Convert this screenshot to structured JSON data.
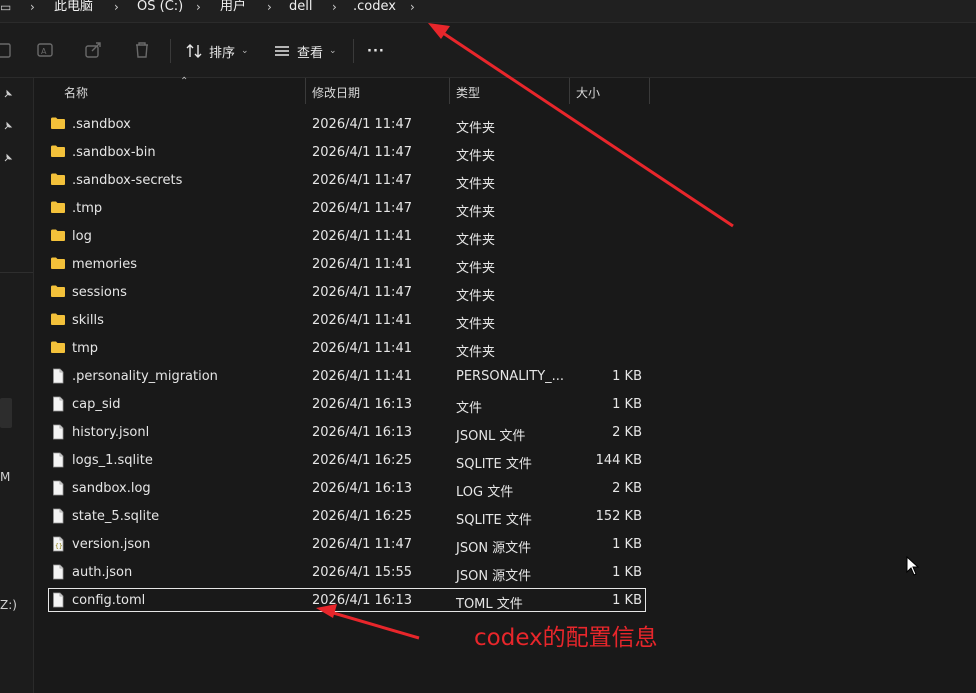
{
  "breadcrumb": [
    "此电脑",
    "OS (C:)",
    "用户",
    "dell",
    ".codex"
  ],
  "toolbar": {
    "sort_label": "排序",
    "view_label": "查看",
    "more_label": "···"
  },
  "sidebar": {
    "letters": [
      "M",
      "Z:)"
    ]
  },
  "columns": {
    "name": "名称",
    "modified": "修改日期",
    "type": "类型",
    "size": "大小"
  },
  "files": [
    {
      "name": ".sandbox",
      "modified": "2026/4/1 11:47",
      "type": "文件夹",
      "size": "",
      "kind": "folder"
    },
    {
      "name": ".sandbox-bin",
      "modified": "2026/4/1 11:47",
      "type": "文件夹",
      "size": "",
      "kind": "folder"
    },
    {
      "name": ".sandbox-secrets",
      "modified": "2026/4/1 11:47",
      "type": "文件夹",
      "size": "",
      "kind": "folder"
    },
    {
      "name": ".tmp",
      "modified": "2026/4/1 11:47",
      "type": "文件夹",
      "size": "",
      "kind": "folder"
    },
    {
      "name": "log",
      "modified": "2026/4/1 11:41",
      "type": "文件夹",
      "size": "",
      "kind": "folder"
    },
    {
      "name": "memories",
      "modified": "2026/4/1 11:41",
      "type": "文件夹",
      "size": "",
      "kind": "folder"
    },
    {
      "name": "sessions",
      "modified": "2026/4/1 11:47",
      "type": "文件夹",
      "size": "",
      "kind": "folder"
    },
    {
      "name": "skills",
      "modified": "2026/4/1 11:41",
      "type": "文件夹",
      "size": "",
      "kind": "folder"
    },
    {
      "name": "tmp",
      "modified": "2026/4/1 11:41",
      "type": "文件夹",
      "size": "",
      "kind": "folder"
    },
    {
      "name": ".personality_migration",
      "modified": "2026/4/1 11:41",
      "type": "PERSONALITY_...",
      "size": "1 KB",
      "kind": "file"
    },
    {
      "name": "cap_sid",
      "modified": "2026/4/1 16:13",
      "type": "文件",
      "size": "1 KB",
      "kind": "file"
    },
    {
      "name": "history.jsonl",
      "modified": "2026/4/1 16:13",
      "type": "JSONL 文件",
      "size": "2 KB",
      "kind": "file"
    },
    {
      "name": "logs_1.sqlite",
      "modified": "2026/4/1 16:25",
      "type": "SQLITE 文件",
      "size": "144 KB",
      "kind": "file"
    },
    {
      "name": "sandbox.log",
      "modified": "2026/4/1 16:13",
      "type": "LOG 文件",
      "size": "2 KB",
      "kind": "file"
    },
    {
      "name": "state_5.sqlite",
      "modified": "2026/4/1 16:25",
      "type": "SQLITE 文件",
      "size": "152 KB",
      "kind": "file"
    },
    {
      "name": "version.json",
      "modified": "2026/4/1 11:47",
      "type": "JSON 源文件",
      "size": "1 KB",
      "kind": "json"
    },
    {
      "name": "auth.json",
      "modified": "2026/4/1 15:55",
      "type": "JSON 源文件",
      "size": "1 KB",
      "kind": "file"
    },
    {
      "name": "config.toml",
      "modified": "2026/4/1 16:13",
      "type": "TOML 文件",
      "size": "1 KB",
      "kind": "file",
      "selected": true
    }
  ],
  "annotation": {
    "text": "codex的配置信息",
    "color": "#e8262b"
  },
  "colors": {
    "background": "#191919",
    "folder": "#f3c13a",
    "annotation_red": "#e8262b"
  }
}
